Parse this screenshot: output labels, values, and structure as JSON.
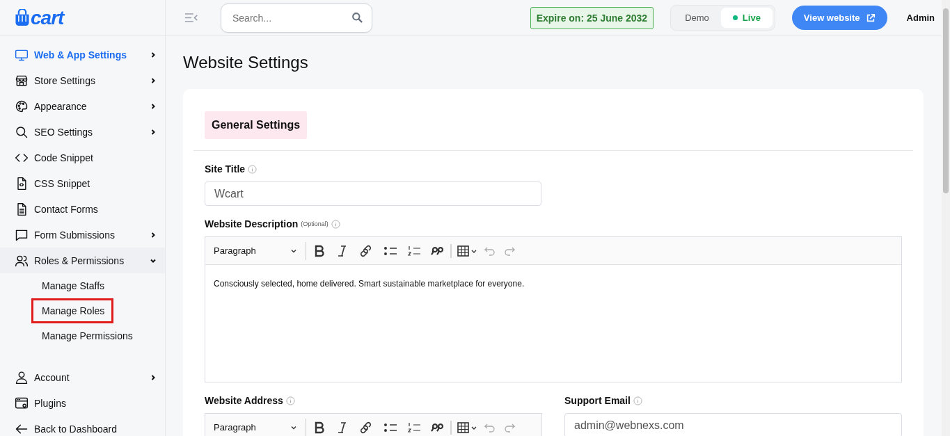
{
  "logo": {
    "text": "cart"
  },
  "sidebar": {
    "items": [
      {
        "label": "Web & App Settings",
        "kind": "group",
        "selected": true,
        "expanded": false
      },
      {
        "label": "Store Settings",
        "kind": "group",
        "selected": false,
        "expanded": false
      },
      {
        "label": "Appearance",
        "kind": "group",
        "selected": false,
        "expanded": false
      },
      {
        "label": "SEO Settings",
        "kind": "group",
        "selected": false,
        "expanded": false
      },
      {
        "label": "Code Snippet",
        "kind": "link",
        "selected": false
      },
      {
        "label": "CSS Snippet",
        "kind": "link",
        "selected": false
      },
      {
        "label": "Contact Forms",
        "kind": "link",
        "selected": false
      },
      {
        "label": "Form Submissions",
        "kind": "group",
        "selected": false,
        "expanded": false
      },
      {
        "label": "Roles & Permissions",
        "kind": "group",
        "selected": false,
        "expanded": true,
        "children": [
          {
            "label": "Manage Staffs",
            "outlined": false
          },
          {
            "label": "Manage Roles",
            "outlined": true
          },
          {
            "label": "Manage Permissions",
            "outlined": false
          }
        ]
      }
    ],
    "footer_items": [
      {
        "label": "Account",
        "kind": "group",
        "selected": false,
        "expanded": false
      },
      {
        "label": "Plugins",
        "kind": "link",
        "selected": false
      },
      {
        "label": "Back to Dashboard",
        "kind": "link",
        "selected": false
      }
    ]
  },
  "header": {
    "search": {
      "placeholder": "Search..."
    },
    "expiry": "Expire on: 25 June 2032",
    "modes": [
      {
        "label": "Demo",
        "selected": false
      },
      {
        "label": "Live",
        "selected": true
      }
    ],
    "view_button": "View website",
    "user": "Admin"
  },
  "page": {
    "title": "Website Settings",
    "section_tab": "General Settings",
    "site_title": {
      "label": "Site Title",
      "value": "Wcart"
    },
    "description": {
      "label": "Website Description",
      "note": "(Optional)",
      "format": "Paragraph",
      "content": "Consciously selected, home delivered. Smart sustainable marketplace for everyone."
    },
    "address": {
      "label": "Website Address",
      "format": "Paragraph"
    },
    "support_email": {
      "label": "Support Email",
      "value": "admin@webnexs.com"
    }
  }
}
